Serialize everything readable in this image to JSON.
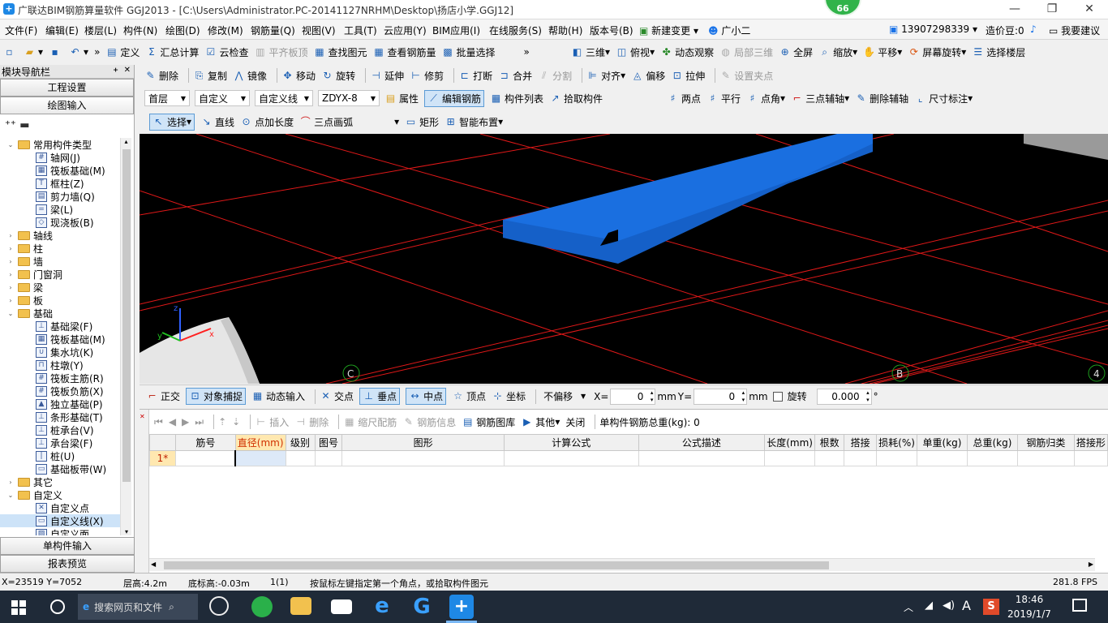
{
  "window": {
    "title": "广联达BIM钢筋算量软件 GGJ2013 - [C:\\Users\\Administrator.PC-20141127NRHM\\Desktop\\扬店小学.GGJ12]",
    "badge": "66",
    "min": "—",
    "restore": "❐",
    "close": "✕"
  },
  "menu": {
    "items": [
      "文件(F)",
      "编辑(E)",
      "楼层(L)",
      "构件(N)",
      "绘图(D)",
      "修改(M)",
      "钢筋量(Q)",
      "视图(V)",
      "工具(T)",
      "云应用(Y)",
      "BIM应用(I)",
      "在线服务(S)",
      "帮助(H)",
      "版本号(B)",
      "新建变更",
      "广小二"
    ],
    "phone": "13907298339",
    "price": "造价豆:0",
    "suggest": "我要建议"
  },
  "toolbar1": {
    "items": [
      "定义",
      "汇总计算",
      "云检查",
      "平齐板顶",
      "查找图元",
      "查看钢筋量",
      "批量选择"
    ],
    "right": [
      "三维",
      "俯视",
      "动态观察",
      "局部三维",
      "全屏",
      "缩放",
      "平移",
      "屏幕旋转",
      "选择楼层"
    ]
  },
  "toolbar2": {
    "items": [
      "删除",
      "复制",
      "镜像",
      "移动",
      "旋转",
      "延伸",
      "修剪",
      "打断",
      "合并",
      "分割",
      "对齐",
      "偏移",
      "拉伸",
      "设置夹点"
    ]
  },
  "toolbar3": {
    "floor": "首层",
    "custom": "自定义",
    "customline": "自定义线",
    "code": "ZDYX-8",
    "items": [
      "属性",
      "编辑钢筋",
      "构件列表",
      "拾取构件"
    ],
    "axis_items": [
      "两点",
      "平行",
      "点角",
      "三点辅轴",
      "删除辅轴",
      "尺寸标注"
    ]
  },
  "toolbar4": {
    "items": [
      "选择",
      "直线",
      "点加长度",
      "三点画弧",
      "矩形",
      "智能布置"
    ]
  },
  "nav": {
    "title": "模块导航栏",
    "project": "工程设置",
    "drawing": "绘图输入",
    "single": "单构件输入",
    "report": "报表预览",
    "tree": [
      {
        "label": "常用构件类型",
        "level": 0,
        "toggle": "⌄",
        "folder": true
      },
      {
        "label": "轴网(J)",
        "level": 1,
        "icon": "#"
      },
      {
        "label": "筏板基础(M)",
        "level": 1,
        "icon": "▦"
      },
      {
        "label": "框柱(Z)",
        "level": 1,
        "icon": "T"
      },
      {
        "label": "剪力墙(Q)",
        "level": 1,
        "icon": "▤"
      },
      {
        "label": "梁(L)",
        "level": 1,
        "icon": "="
      },
      {
        "label": "现浇板(B)",
        "level": 1,
        "icon": "◇"
      },
      {
        "label": "轴线",
        "level": 0,
        "toggle": "›",
        "folder": true
      },
      {
        "label": "柱",
        "level": 0,
        "toggle": "›",
        "folder": true
      },
      {
        "label": "墙",
        "level": 0,
        "toggle": "›",
        "folder": true
      },
      {
        "label": "门窗洞",
        "level": 0,
        "toggle": "›",
        "folder": true
      },
      {
        "label": "梁",
        "level": 0,
        "toggle": "›",
        "folder": true
      },
      {
        "label": "板",
        "level": 0,
        "toggle": "›",
        "folder": true
      },
      {
        "label": "基础",
        "level": 0,
        "toggle": "⌄",
        "folder": true
      },
      {
        "label": "基础梁(F)",
        "level": 1,
        "icon": "⊥"
      },
      {
        "label": "筏板基础(M)",
        "level": 1,
        "icon": "▦"
      },
      {
        "label": "集水坑(K)",
        "level": 1,
        "icon": "∪"
      },
      {
        "label": "柱墩(Y)",
        "level": 1,
        "icon": "⊓"
      },
      {
        "label": "筏板主筋(R)",
        "level": 1,
        "icon": "#"
      },
      {
        "label": "筏板负筋(X)",
        "level": 1,
        "icon": "#"
      },
      {
        "label": "独立基础(P)",
        "level": 1,
        "icon": "▲"
      },
      {
        "label": "条形基础(T)",
        "level": 1,
        "icon": "⊥"
      },
      {
        "label": "桩承台(V)",
        "level": 1,
        "icon": "⊥"
      },
      {
        "label": "承台梁(F)",
        "level": 1,
        "icon": "⊥"
      },
      {
        "label": "桩(U)",
        "level": 1,
        "icon": "|"
      },
      {
        "label": "基础板带(W)",
        "level": 1,
        "icon": "▭"
      },
      {
        "label": "其它",
        "level": 0,
        "toggle": "›",
        "folder": true
      },
      {
        "label": "自定义",
        "level": 0,
        "toggle": "⌄",
        "folder": true
      },
      {
        "label": "自定义点",
        "level": 1,
        "icon": "✕"
      },
      {
        "label": "自定义线(X)",
        "level": 1,
        "icon": "▭"
      },
      {
        "label": "自定义面",
        "level": 1,
        "icon": "▨"
      }
    ]
  },
  "viewport": {
    "axis_labels": [
      "C",
      "B",
      "4"
    ],
    "gizmo_labels": {
      "x": "x",
      "y": "y",
      "z": "z"
    }
  },
  "snap": {
    "items": [
      "正交",
      "对象捕捉",
      "动态输入",
      "交点",
      "垂点",
      "中点",
      "顶点",
      "坐标"
    ],
    "offset": "不偏移",
    "x_label": "X=",
    "x_value": "0",
    "y_label": "Y=",
    "y_value": "0",
    "unit": "mm",
    "rotate": "旋转",
    "rotate_value": "0.000",
    "degree": "°"
  },
  "grid": {
    "toolbar": [
      "插入",
      "删除",
      "缩尺配筋",
      "钢筋信息",
      "钢筋图库",
      "其他",
      "关闭"
    ],
    "total": "单构件钢筋总重(kg): 0",
    "columns": [
      "",
      "筋号",
      "直径(mm)",
      "级别",
      "图号",
      "图形",
      "计算公式",
      "公式描述",
      "长度(mm)",
      "根数",
      "搭接",
      "损耗(%)",
      "单重(kg)",
      "总重(kg)",
      "钢筋归类",
      "搭接形"
    ],
    "row1": "1*"
  },
  "status": {
    "coords": "X=23519 Y=7052",
    "floor_height": "层高:4.2m",
    "base_height": "底标高:-0.03m",
    "count": "1(1)",
    "hint": "按鼠标左键指定第一个角点，或拾取构件图元",
    "fps": "281.8 FPS"
  },
  "taskbar": {
    "search": "搜索网页和文件",
    "time": "18:46",
    "date": "2019/1/7",
    "ime": "A"
  }
}
